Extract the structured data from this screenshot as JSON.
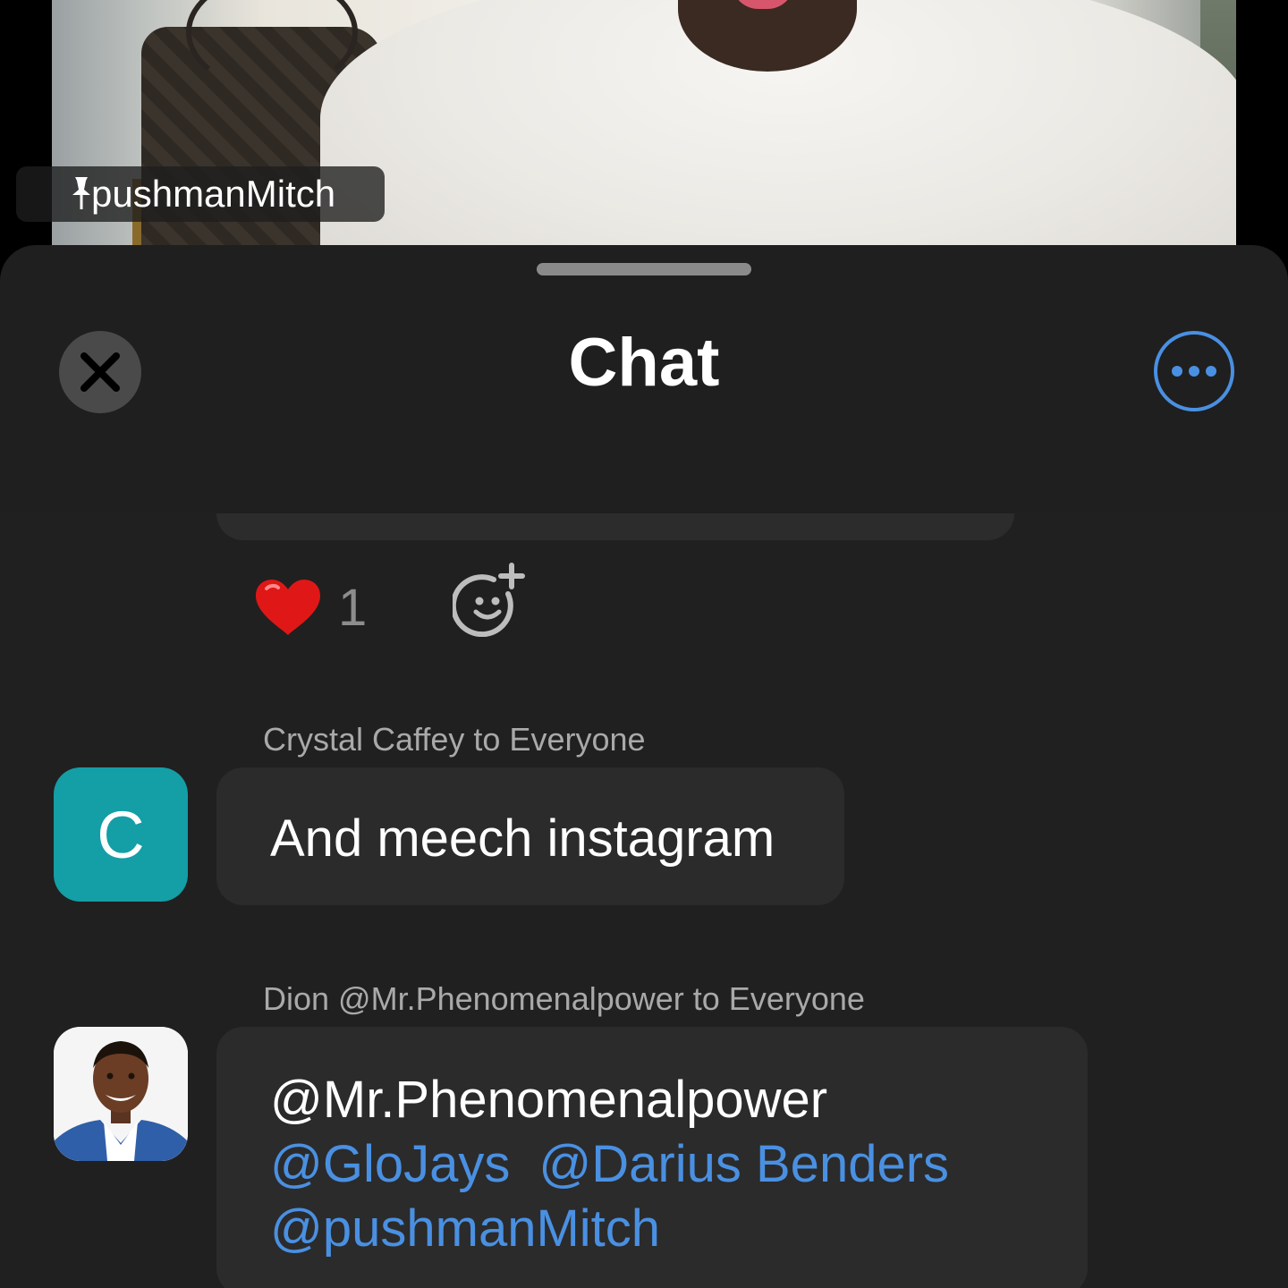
{
  "video": {
    "participant_name": "pushmanMitch"
  },
  "chat": {
    "title": "Chat",
    "reactions": [
      {
        "emoji": "heart",
        "count": "1"
      }
    ],
    "messages": [
      {
        "sender_line": "Crystal Caffey to Everyone",
        "avatar_letter": "C",
        "avatar_color": "#149ea6",
        "text": "And meech instagram"
      },
      {
        "sender_line": "Dion @Mr.Phenomenalpower to Everyone",
        "text_lines": [
          {
            "parts": [
              "@Mr.Phenomenalpower"
            ]
          },
          {
            "parts": [
              "@GloJays",
              "@Darius Benders"
            ]
          },
          {
            "parts": [
              "@pushmanMitch"
            ]
          }
        ]
      }
    ]
  },
  "colors": {
    "sheet_background": "#1f1f1f",
    "bubble": "#2b2b2b",
    "mention": "#4a90e2",
    "accent": "#4a90e2"
  }
}
